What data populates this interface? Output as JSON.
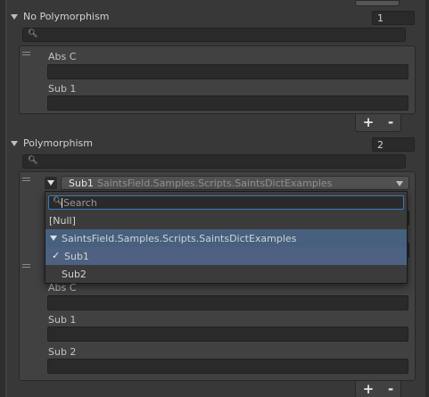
{
  "no_poly": {
    "title": "No Polymorphism",
    "count": "1",
    "items": [
      {
        "label": "Abs C"
      },
      {
        "label": "Sub 1"
      }
    ]
  },
  "poly": {
    "title": "Polymorphism",
    "count": "2",
    "element0": {
      "type_name": "Sub1",
      "type_namespace": "SaintsField.Samples.Scripts.SaintsDictExamples"
    },
    "items": [
      {
        "label": "Abs C"
      },
      {
        "label": "Sub 1"
      },
      {
        "label": "Sub 2"
      }
    ]
  },
  "popup": {
    "search_placeholder": "Search",
    "null_option": "[Null]",
    "group_label": "SaintsField.Samples.Scripts.SaintsDictExamples",
    "options": [
      {
        "label": "Sub1",
        "selected": true
      },
      {
        "label": "Sub2",
        "selected": false
      }
    ]
  },
  "footer": {
    "add": "+",
    "remove": "-"
  }
}
